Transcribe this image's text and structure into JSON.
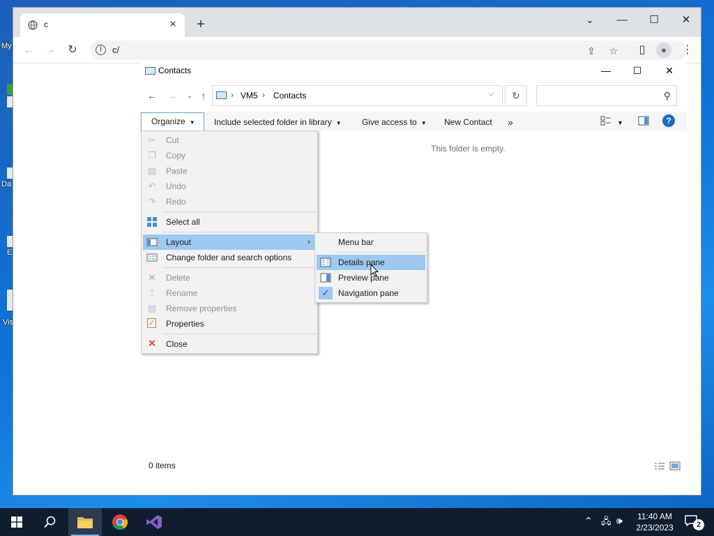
{
  "desktop": {
    "labels": [
      "My",
      "Da",
      "E",
      "Vis"
    ]
  },
  "browser": {
    "tab_title": "c",
    "url": "c/"
  },
  "explorer": {
    "title": "Contacts",
    "breadcrumb": [
      "VM5",
      "Contacts"
    ],
    "search_placeholder": "",
    "commands": {
      "organize": "Organize",
      "include": "Include selected folder in library",
      "give_access": "Give access to",
      "new_contact": "New Contact",
      "more": "»"
    },
    "empty_message": "This folder is empty.",
    "status": "0 items"
  },
  "organize_menu": {
    "items": [
      {
        "label": "Cut",
        "icon": "scissors-icon",
        "enabled": false
      },
      {
        "label": "Copy",
        "icon": "copy-icon",
        "enabled": false
      },
      {
        "label": "Paste",
        "icon": "paste-icon",
        "enabled": false
      },
      {
        "label": "Undo",
        "icon": "undo-icon",
        "enabled": false
      },
      {
        "label": "Redo",
        "icon": "redo-icon",
        "enabled": false
      },
      {
        "label": "Select all",
        "icon": "select-all-icon",
        "enabled": true
      },
      {
        "label": "Layout",
        "icon": "layout-icon",
        "enabled": true,
        "highlighted": true,
        "submenu": true
      },
      {
        "label": "Change folder and search options",
        "icon": "folder-options-icon",
        "enabled": true
      },
      {
        "label": "Delete",
        "icon": "delete-x-icon",
        "enabled": false
      },
      {
        "label": "Rename",
        "icon": "rename-icon",
        "enabled": false
      },
      {
        "label": "Remove properties",
        "icon": "remove-properties-icon",
        "enabled": false
      },
      {
        "label": "Properties",
        "icon": "properties-check-icon",
        "enabled": true
      },
      {
        "label": "Close",
        "icon": "close-red-x-icon",
        "enabled": true
      }
    ]
  },
  "layout_menu": {
    "items": [
      {
        "label": "Menu bar",
        "checked": false,
        "highlighted": false
      },
      {
        "label": "Details pane",
        "checked": false,
        "highlighted": true
      },
      {
        "label": "Preview pane",
        "checked": false,
        "highlighted": false
      },
      {
        "label": "Navigation pane",
        "checked": true,
        "highlighted": false
      }
    ]
  },
  "taskbar": {
    "time": "11:40 AM",
    "date": "2/23/2023",
    "notification_count": "2"
  },
  "colors": {
    "highlight": "#9dc9f3",
    "accent": "#1b6ac9",
    "taskbar": "#101d2f"
  }
}
